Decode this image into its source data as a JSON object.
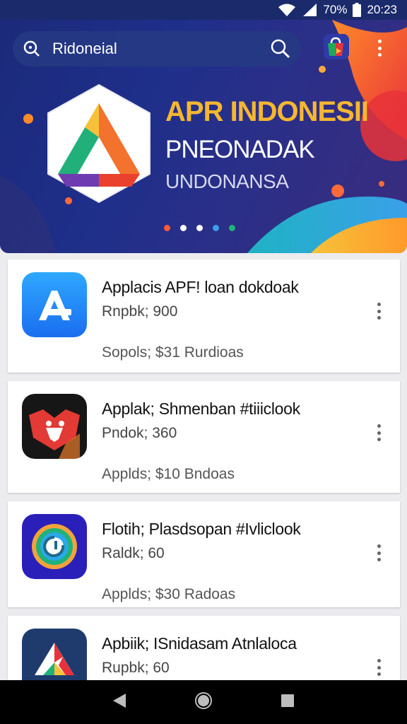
{
  "status_bar": {
    "battery_percent": "70%",
    "time": "20:23",
    "icons": [
      "wifi-icon",
      "signal-icon",
      "battery-icon"
    ]
  },
  "search": {
    "value": "Ridoneial",
    "icons": [
      "search-leading-icon",
      "search-icon"
    ]
  },
  "header_actions": {
    "icons": [
      "shopping-bag-icon",
      "more-vert-icon"
    ]
  },
  "banner": {
    "title": "APR INDONESII",
    "subtitle": "PNEONADAK",
    "tagline": "UNDONANSA",
    "page_count": 5,
    "active_page": 1,
    "colors": {
      "title": "#f5b731",
      "background": "#1e2f8a"
    }
  },
  "apps": [
    {
      "name": "Applacis APF! loan dokdoak",
      "developer": "Rnpbk; 900",
      "meta": "Sopols; $31 Rurdioas",
      "icon": "app-store-icon"
    },
    {
      "name": "Applak; Shmenban #tiiiclook",
      "developer": "Pndok; 360",
      "meta": "Applds; $10 Bndoas",
      "icon": "bird-icon"
    },
    {
      "name": "Flotih; Plasdsopan #Ivliclook",
      "developer": "Raldk; 60",
      "meta": "Applds; $30 Radoas",
      "icon": "target-icon"
    },
    {
      "name": "Apbiik; ISnidasam Atnlaloca",
      "developer": "Rupbk; 60",
      "meta": "",
      "icon": "drive-icon"
    }
  ],
  "nav_bar": {
    "icons": [
      "back-icon",
      "home-icon",
      "recents-icon"
    ]
  }
}
